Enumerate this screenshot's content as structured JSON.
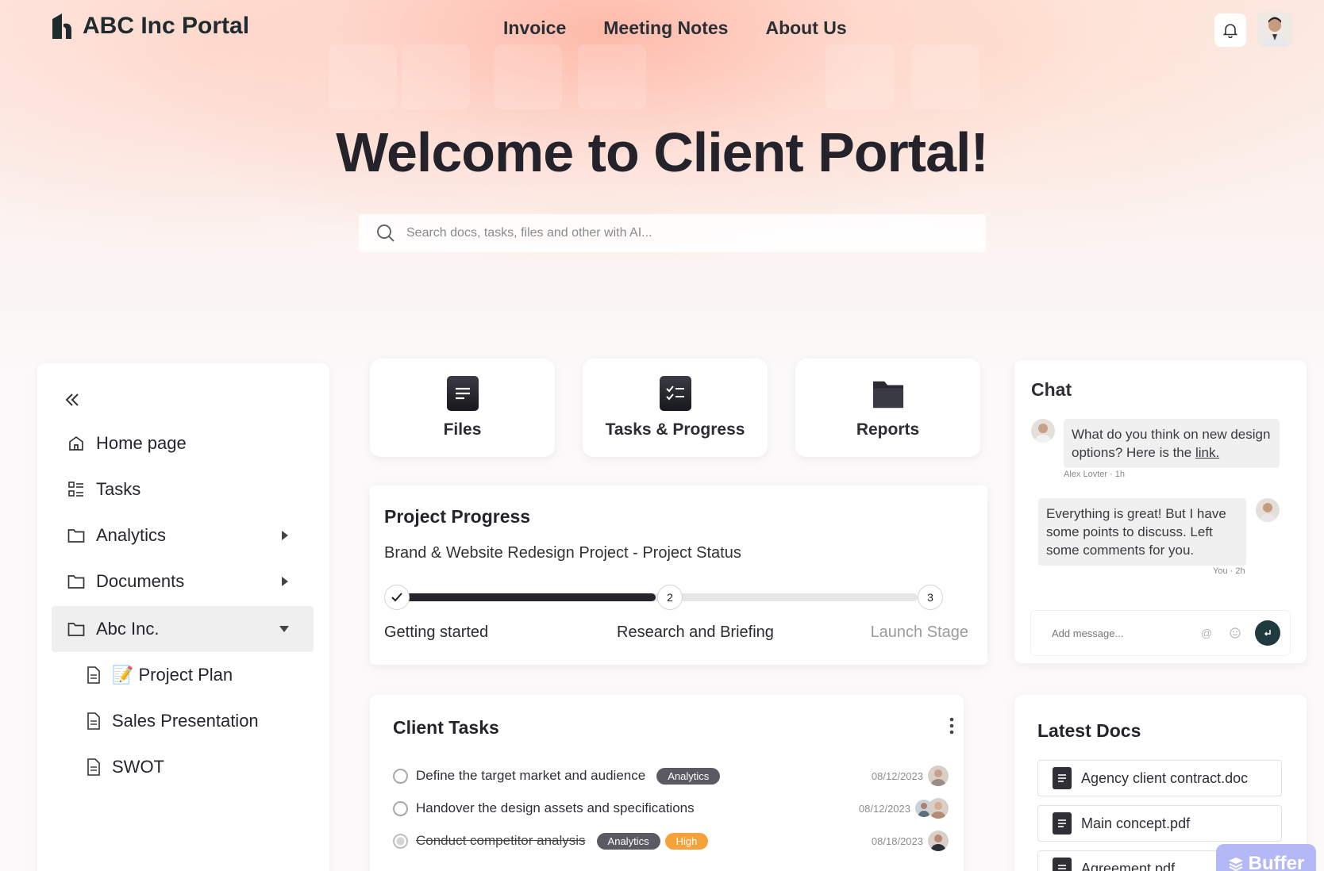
{
  "header": {
    "brand": "ABC Inc Portal",
    "nav": [
      "Invoice",
      "Meeting Notes",
      "About Us"
    ]
  },
  "hero": {
    "title": "Welcome to Client Portal!",
    "search_placeholder": "Search docs, tasks, files and other with AI..."
  },
  "sidebar": {
    "items": [
      {
        "label": "Home page",
        "icon": "home-icon"
      },
      {
        "label": "Tasks",
        "icon": "tasks-icon"
      },
      {
        "label": "Analytics",
        "icon": "folder-icon"
      },
      {
        "label": "Documents",
        "icon": "folder-icon"
      },
      {
        "label": "Abc Inc.",
        "icon": "folder-icon"
      }
    ],
    "subitems": [
      {
        "label": "📝 Project Plan",
        "icon": "document-icon"
      },
      {
        "label": "Sales Presentation",
        "icon": "document-icon"
      },
      {
        "label": "SWOT",
        "icon": "document-icon"
      }
    ]
  },
  "quick_cards": [
    "Files",
    "Tasks & Progress",
    "Reports"
  ],
  "progress": {
    "title": "Project Progress",
    "subtitle": "Brand & Website Redesign Project - Project Status",
    "steps": [
      {
        "num": "",
        "label": "Getting started",
        "state": "done"
      },
      {
        "num": "2",
        "label": "Research and Briefing",
        "state": "current"
      },
      {
        "num": "3",
        "label": "Launch Stage",
        "state": "upcoming"
      }
    ],
    "completion": 0.5
  },
  "client_tasks": {
    "title": "Client Tasks",
    "rows": [
      {
        "name": "Define the target market and audience",
        "tags": [
          "Analytics"
        ],
        "date": "08/12/2023",
        "done": false
      },
      {
        "name": "Handover the design assets and specifications",
        "tags": [],
        "date": "08/12/2023",
        "done": false
      },
      {
        "name": "Conduct competitor analysis",
        "tags": [
          "Analytics",
          "High"
        ],
        "date": "08/18/2023",
        "done": true
      }
    ]
  },
  "chat": {
    "title": "Chat",
    "messages": [
      {
        "text": "What do you think on new design options? Here is the",
        "link": "link.",
        "meta": "Alex Lovter · 1h"
      },
      {
        "text": "Everything is great! But I have some points to discuss. Left some comments for you.",
        "meta": "You · 2h"
      }
    ],
    "input_placeholder": "Add message..."
  },
  "latest_docs": {
    "title": "Latest Docs",
    "items": [
      "Agency client contract.doc",
      "Main concept.pdf",
      "Agreement.pdf"
    ]
  },
  "buffer_badge": "Buffer",
  "colors": {
    "accent_dark": "#1f3b3f",
    "high_tag": "#f6a23a",
    "tag_gray": "#5b5a62"
  }
}
